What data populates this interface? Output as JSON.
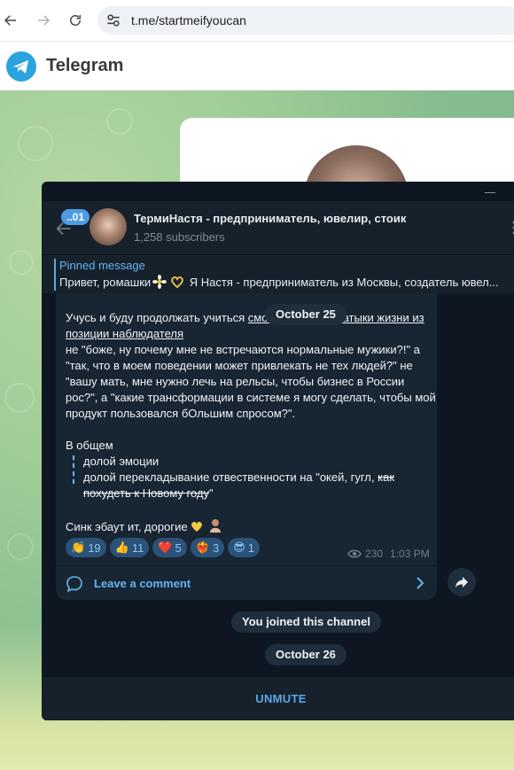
{
  "browser": {
    "url": "t.me/startmeifyoucan"
  },
  "telegram_web": {
    "title": "Telegram"
  },
  "channel": {
    "name": "ТермиНастя - предприниматель, ювелир, стоик",
    "subscribers": "1,258 subscribers",
    "unread_badge": "..01"
  },
  "pinned": {
    "title": "Pinned message",
    "text_start": "Привет, ромашки",
    "text_end": "Я Настя - предприниматель из Москвы, создатель ювел..."
  },
  "message": {
    "line1_plain": "Учусь и буду продолжать учиться ",
    "line1_link": "смотреть на все затыки жизни из позиции наблюдателя",
    "para1": "не \"боже, ну почему мне не встречаются нормальные мужики?!\" а \"так, что в моем поведении может привлекать не тех людей?\" не \"вашу мать, мне нужно лечь на рельсы, чтобы бизнес в России рос?\", а \"какие трансформации в системе я могу сделать, чтобы мой продукт пользовался бОльшим спросом?\".",
    "in_general": "В общем",
    "bullet1": "долой эмоции",
    "bullet2_plain": "долой перекладывание отвественности на \"окей, гугл, ",
    "bullet2_strike": "как похудеть к Новому году",
    "bullet2_end": "\"",
    "closing": "Синк эбаут ит, дорогие",
    "views": "230",
    "time": "1:03 PM",
    "comment_label": "Leave a comment"
  },
  "reactions": [
    {
      "emoji": "👏",
      "count": "19"
    },
    {
      "emoji": "👍",
      "count": "11"
    },
    {
      "emoji": "❤️",
      "count": "5"
    },
    {
      "emoji": "❤️‍🔥",
      "count": "3"
    },
    {
      "emoji": "😎",
      "count": "1"
    }
  ],
  "dates": {
    "first": "October 25",
    "second": "October 26"
  },
  "service": {
    "joined": "You joined this channel"
  },
  "composer": {
    "unmute_label": "UNMUTE"
  },
  "colors": {
    "accent": "#5aa8e6",
    "window_bg": "#0e1621",
    "bubble_bg": "#182533",
    "reaction_bg": "#2b5278"
  }
}
